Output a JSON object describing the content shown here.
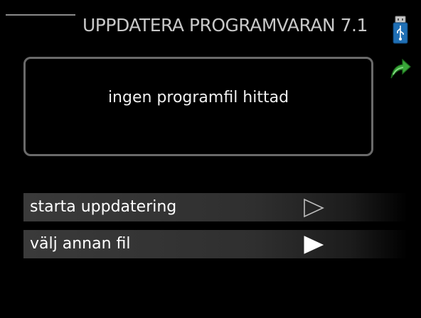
{
  "header": {
    "title": "UPPDATERA PROGRAMVARAN 7.1",
    "icons": [
      "usb-icon",
      "back-arrow-icon"
    ]
  },
  "info": {
    "message": "ingen programfil hittad"
  },
  "menu": {
    "items": [
      {
        "label": "starta uppdatering",
        "arrow": "outline"
      },
      {
        "label": "välj annan fil",
        "arrow": "filled"
      }
    ]
  },
  "colors": {
    "background": "#000000",
    "title": "#c8c8c8",
    "box_border": "#6a6a6a",
    "row": "#3a3a3a",
    "icon_blue": "#1f6fb5",
    "icon_green": "#3aa83a"
  }
}
